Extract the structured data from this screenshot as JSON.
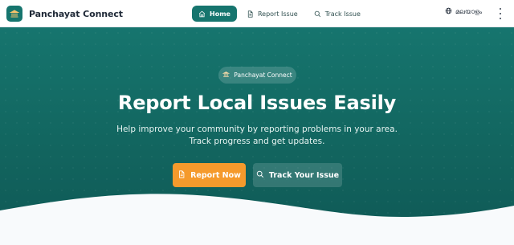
{
  "navbar": {
    "brand": {
      "name": "Panchayat Connect",
      "icon": "bank-icon"
    },
    "links": [
      {
        "label": "Home",
        "icon": "home-icon",
        "active": true
      },
      {
        "label": "Report Issue",
        "icon": "document-icon",
        "active": false
      },
      {
        "label": "Track Issue",
        "icon": "search-icon",
        "active": false
      }
    ],
    "language": {
      "label": "മലയാളം",
      "icon": "globe-icon"
    },
    "menu_icon": "kebab-menu-icon"
  },
  "hero": {
    "badge": {
      "label": "Panchayat Connect",
      "icon": "bank-icon"
    },
    "title": "Report Local Issues Easily",
    "subtitle_line1": "Help improve your community by reporting problems in your area.",
    "subtitle_line2": "Track progress and get updates.",
    "buttons": {
      "primary": {
        "label": "Report Now",
        "icon": "document-icon"
      },
      "secondary": {
        "label": "Track Your Issue",
        "icon": "search-icon"
      }
    }
  },
  "colors": {
    "brand_teal": "#16756e",
    "hero_dark": "#0f5855",
    "accent_orange": "#f59a2c",
    "background": "#ffffff",
    "text_dark": "#1f2937"
  }
}
